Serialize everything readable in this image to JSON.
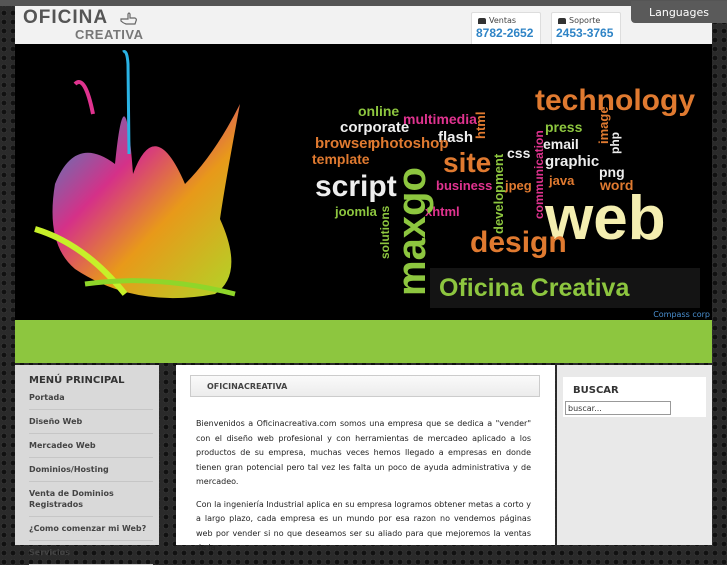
{
  "header": {
    "logo_line1": "OFICINA",
    "logo_line2": "CREATIVA",
    "sales": {
      "label": "Ventas",
      "phone": "8782-2652"
    },
    "support": {
      "label": "Soporte",
      "phone": "2453-3765"
    },
    "languages_label": "Languages"
  },
  "banner": {
    "words": [
      "online",
      "multimedia",
      "html",
      "technology",
      "corporate",
      "flash",
      "press",
      "image",
      "browser",
      "photoshop",
      "email",
      "php",
      "template",
      "site",
      "css",
      "graphic",
      "png",
      "script",
      "business",
      "jpeg",
      "java",
      "word",
      "development",
      "communication",
      "joomla",
      "xhtml",
      "maxgo",
      "solutions",
      "web",
      "design"
    ],
    "tagline": "Oficina Creativa",
    "credit": "Compass corp"
  },
  "left_menu": {
    "title": "MENÚ PRINCIPAL",
    "items": [
      "Portada",
      "Diseño Web",
      "Mercadeo Web",
      "Dominios/Hosting",
      "Venta de Dominios Registrados",
      "¿Como comenzar mi Web?",
      "Servicios"
    ]
  },
  "main": {
    "title": "OFICINACREATIVA",
    "paragraph1": "Bienvenidos a Oficinacreativa.com somos una empresa que se dedica a \"vender\" con el diseño web profesional y con herramientas de mercadeo aplicado a los productos de su empresa, muchas veces hemos llegado a empresas en donde tienen gran potencial pero tal vez les falta un poco de ayuda administrativa y de mercadeo.",
    "paragraph2": "Con la ingeniería Industrial aplica en su empresa logramos obtener metas a corto y a largo plazo, cada empresa es un mundo por esa razon no vendemos páginas web por vender si no que deseamos ser su aliado para que mejoremos la ventas de la"
  },
  "right": {
    "search_title": "BUSCAR",
    "search_value": "buscar..."
  },
  "colors": {
    "accent_green": "#8dc63f",
    "phone_blue": "#2f84c6",
    "banner_orange": "#e07a30"
  }
}
